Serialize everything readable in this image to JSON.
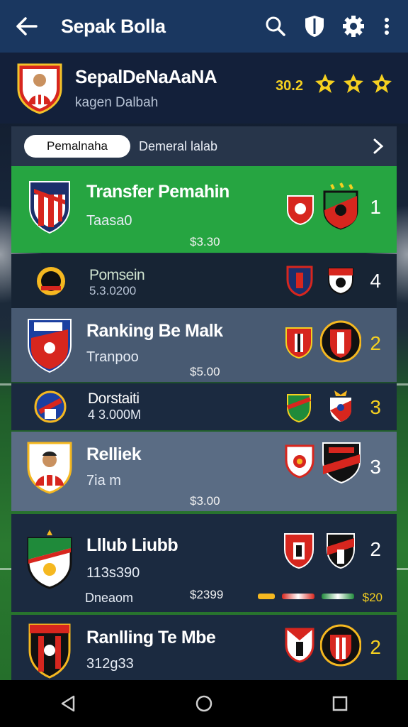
{
  "appbar": {
    "title": "Sepak Bolla"
  },
  "profile": {
    "name": "SepalDeNaAaNA",
    "subtitle": "kagen Dalbah",
    "score": "30.2"
  },
  "tabs": {
    "active": "Pemalnaha",
    "other": "Demeral lalab"
  },
  "rows": [
    {
      "title": "Transfer Pemahin",
      "sub": "Taasa0",
      "price": "$3.30",
      "num": "1"
    },
    {
      "title": "Pomsein",
      "sub": "5.3.0200",
      "price": "",
      "num": "4"
    },
    {
      "title": "Ranking Be Malk",
      "sub": "Tranpoo",
      "price": "$5.00",
      "num": "2"
    },
    {
      "title": "Dorstaiti",
      "sub": "4 3.000M",
      "price": "",
      "num": "3"
    },
    {
      "title": "Relliek",
      "sub": "7ia m",
      "price": "$3.00",
      "num": "3"
    },
    {
      "title": "Lllub Liubb",
      "sub": "113s390",
      "extra": "Dneaom",
      "price": "$2399",
      "tag": "$20",
      "num": "2"
    },
    {
      "title": "Ranlling Te Mbe",
      "sub": "312g33",
      "price": "",
      "num": "2"
    }
  ],
  "colors": {
    "appbar": "#1a3760",
    "green": "#26a541",
    "gold": "#f5d020"
  }
}
